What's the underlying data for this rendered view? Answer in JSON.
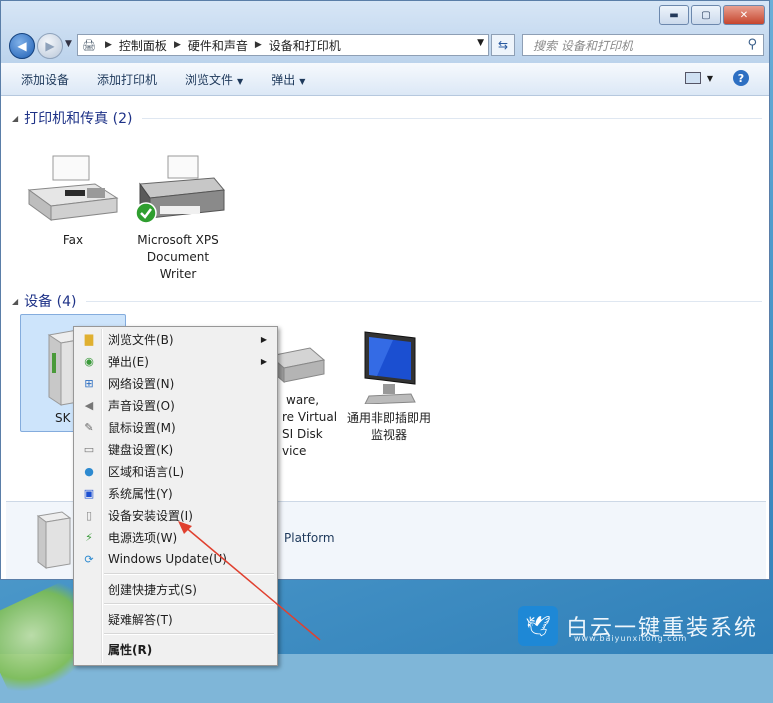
{
  "window": {
    "controls": {
      "minimize": "▬",
      "maximize": "▢",
      "close": "✕"
    }
  },
  "nav": {
    "breadcrumb": [
      "控制面板",
      "硬件和声音",
      "设备和打印机"
    ],
    "search_placeholder": "搜索 设备和打印机"
  },
  "toolbar": {
    "add_device": "添加设备",
    "add_printer": "添加打印机",
    "browse_files": "浏览文件",
    "eject": "弹出"
  },
  "groups": {
    "printers": {
      "title": "打印机和传真 (2)",
      "items": [
        {
          "label": "Fax"
        },
        {
          "label_lines": [
            "Microsoft XPS",
            "Document",
            "Writer"
          ]
        }
      ]
    },
    "devices": {
      "title": "设备 (4)",
      "items": [
        {
          "label": "SK"
        },
        {
          "label_lines": [
            "ware,",
            "re Virtual",
            "SI Disk",
            "vice"
          ]
        },
        {
          "label_lines": [
            "通用非即插即用",
            "监视器"
          ]
        }
      ]
    }
  },
  "details": {
    "partial_text": "Platform"
  },
  "context_menu": {
    "items": [
      {
        "label": "浏览文件(B)",
        "icon": "folder-icon",
        "submenu": true
      },
      {
        "label": "弹出(E)",
        "icon": "eject-icon",
        "submenu": true
      },
      {
        "label": "网络设置(N)",
        "icon": "network-icon"
      },
      {
        "label": "声音设置(O)",
        "icon": "speaker-icon"
      },
      {
        "label": "鼠标设置(M)",
        "icon": "mouse-icon"
      },
      {
        "label": "键盘设置(K)",
        "icon": "keyboard-icon"
      },
      {
        "label": "区域和语言(L)",
        "icon": "globe-icon"
      },
      {
        "label": "系统属性(Y)",
        "icon": "computer-icon"
      },
      {
        "label": "设备安装设置(I)",
        "icon": "device-install-icon"
      },
      {
        "label": "电源选项(W)",
        "icon": "power-icon"
      },
      {
        "label": "Windows Update(U)",
        "icon": "windows-update-icon"
      },
      {
        "label": "创建快捷方式(S)"
      },
      {
        "label": "疑难解答(T)"
      },
      {
        "label": "属性(R)"
      }
    ]
  },
  "watermark": {
    "text": "白云一键重装系统",
    "url": "www.baiyunxitong.com"
  },
  "colors": {
    "accent": "#1e3287",
    "selection": "#cde4fb",
    "arrow": "#e0402f"
  }
}
